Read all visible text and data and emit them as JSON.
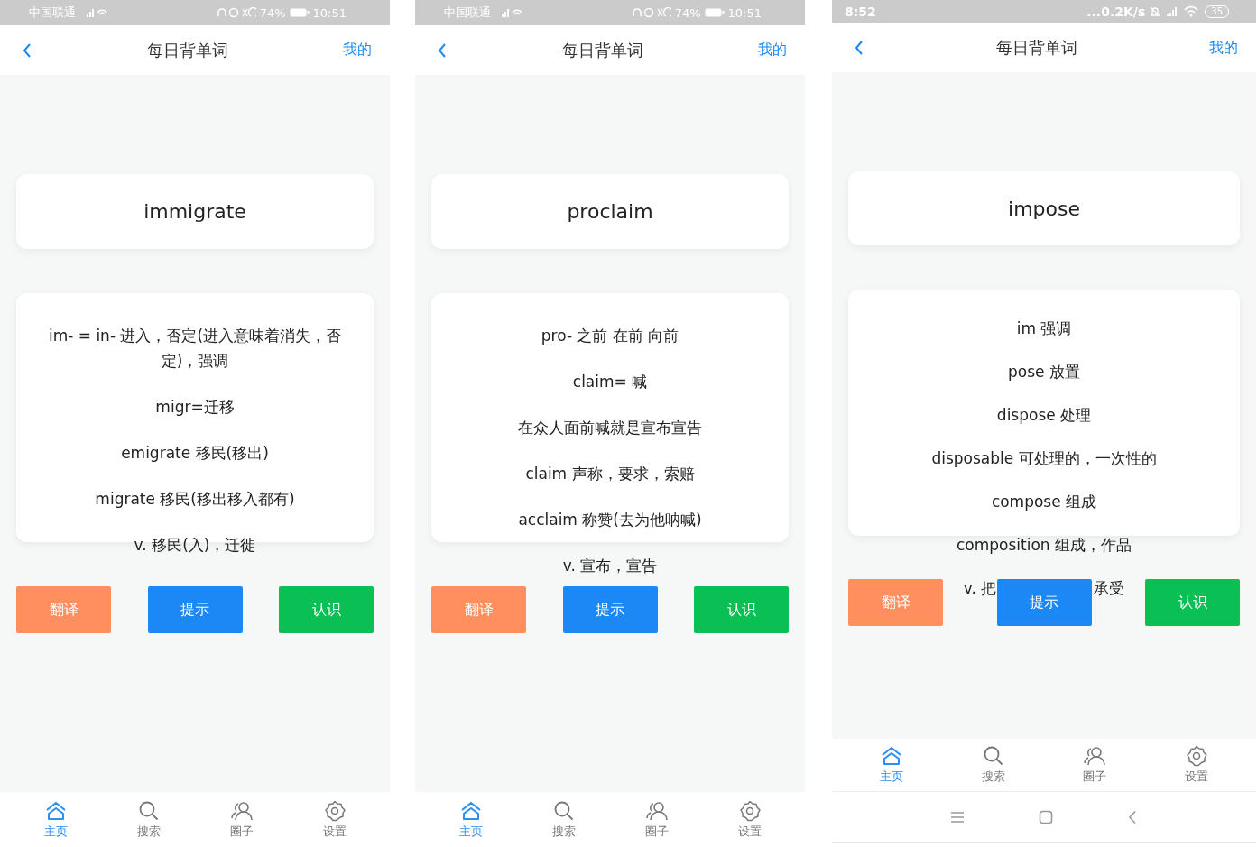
{
  "phones": [
    {
      "status_bar": {
        "kind": "emui",
        "carrier": "中国联通",
        "battery": "74%",
        "time": "10:51"
      },
      "header": {
        "title": "每日背单词",
        "action": "我的"
      },
      "word": "immigrate",
      "notes": [
        {
          "text": "im- = in- 进入，否定(进入意味着消失，否定)，强调"
        },
        {
          "text": "migr=迁移"
        },
        {
          "text": "emigrate 移民(移出)"
        },
        {
          "text": "migrate 移民(移出移入都有)"
        },
        {
          "text": "v. 移民(入)，迁徙"
        }
      ],
      "buttons": [
        {
          "label": "翻译",
          "color": "#ff8f5f"
        },
        {
          "label": "提示",
          "color": "#1b88f5"
        },
        {
          "label": "认识",
          "color": "#0abf53"
        }
      ],
      "tabs": [
        {
          "label": "主页",
          "selected": true
        },
        {
          "label": "搜索",
          "selected": false
        },
        {
          "label": "圈子",
          "selected": false
        },
        {
          "label": "设置",
          "selected": false
        }
      ]
    },
    {
      "status_bar": {
        "kind": "emui",
        "carrier": "中国联通",
        "battery": "74%",
        "time": "10:51"
      },
      "header": {
        "title": "每日背单词",
        "action": "我的"
      },
      "word": "proclaim",
      "notes": [
        {
          "text": "pro- 之前 在前 向前"
        },
        {
          "text": "claim= 喊"
        },
        {
          "text": "在众人面前喊就是宣布宣告"
        },
        {
          "text": "claim 声称，要求，索赔"
        },
        {
          "text": "acclaim 称赞(去为他呐喊)"
        },
        {
          "text": "v. 宣布，宣告"
        }
      ],
      "buttons": [
        {
          "label": "翻译",
          "color": "#ff8f5f"
        },
        {
          "label": "提示",
          "color": "#1b88f5"
        },
        {
          "label": "认识",
          "color": "#0abf53"
        }
      ],
      "tabs": [
        {
          "label": "主页",
          "selected": true
        },
        {
          "label": "搜索",
          "selected": false
        },
        {
          "label": "圈子",
          "selected": false
        },
        {
          "label": "设置",
          "selected": false
        }
      ]
    },
    {
      "status_bar": {
        "kind": "miui",
        "speed": "...0.2K/s",
        "battery": "35",
        "time": "8:52"
      },
      "header": {
        "title": "每日背单词",
        "action": "我的"
      },
      "word": "impose",
      "notes": [
        {
          "text": "im 强调"
        },
        {
          "text": "pose 放置"
        },
        {
          "text": "dispose 处理"
        },
        {
          "text": "disposable 可处理的，一次性的"
        },
        {
          "text": "compose 组成"
        },
        {
          "text": "composition 组成，作品"
        },
        {
          "parts": [
            "v. 把",
            "承受"
          ]
        }
      ],
      "buttons": [
        {
          "label": "翻译",
          "color": "#ff8f5f"
        },
        {
          "label": "提示",
          "color": "#1b88f5"
        },
        {
          "label": "认识",
          "color": "#0abf53"
        }
      ],
      "tabs": [
        {
          "label": "主页",
          "selected": true
        },
        {
          "label": "搜索",
          "selected": false
        },
        {
          "label": "圈子",
          "selected": false
        },
        {
          "label": "设置",
          "selected": false
        }
      ]
    }
  ]
}
